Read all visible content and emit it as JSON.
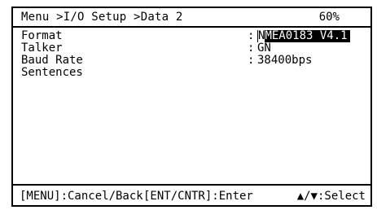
{
  "header": {
    "breadcrumb": "Menu >I/O Setup >Data 2",
    "progress": "60%"
  },
  "settings": [
    {
      "label": "Format",
      "colon": ":",
      "value_cursor": "N",
      "value_rest": "MEA0183 V4.1",
      "selected": true
    },
    {
      "label": "Talker",
      "colon": ":",
      "value": "GN"
    },
    {
      "label": "Baud Rate",
      "colon": ":",
      "value": "38400bps"
    },
    {
      "label": "Sentences"
    }
  ],
  "footer": {
    "cancel": "[MENU]:Cancel/Back",
    "enter": "[ENT/CNTR]:Enter",
    "select": "▲/▼:Select"
  }
}
